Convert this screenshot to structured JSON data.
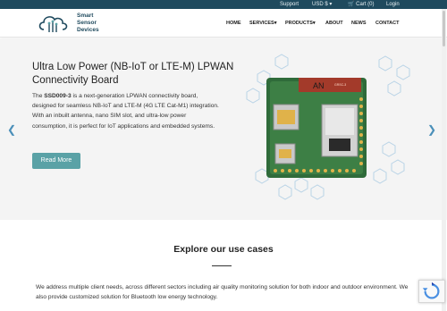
{
  "topbar": {
    "support": "Support",
    "currency": "USD $",
    "cart": "Cart (0)",
    "login": "Login"
  },
  "brand": {
    "line1": "Smart",
    "line2": "Sensor",
    "line3": "Devices",
    "color": "#1f4a5e"
  },
  "nav": {
    "home": "HOME",
    "services": "SERVICES",
    "products": "PRODUCTS",
    "about": "ABOUT",
    "news": "NEWS",
    "contact": "CONTACT"
  },
  "hero": {
    "title": "Ultra Low Power (NB-IoT or LTE-M) LPWAN Connectivity Board",
    "body_prefix": "The ",
    "body_product": "SSD009-3",
    "body_rest": " is a next-generation LPWAN connectivity board, designed for seamless NB-IoT and LTE-M (4G LTE Cat-M1) integration. With an inbuilt antenna, nano SIM slot, and ultra-low power consumption, it is perfect for IoT applications and embedded systems.",
    "button": "Read More",
    "accent": "#5aa2a6",
    "board_label": "AN",
    "board_tag": "GRSC-3"
  },
  "section": {
    "title": "Explore our use cases",
    "description": "We address multiple client needs, across different sectors including air quality monitoring solution for both indoor and outdoor environment. We also provide customized solution for Bluetooth low energy technology."
  },
  "icons": {
    "cart": "cart-icon",
    "prev": "chevron-left-icon",
    "next": "chevron-right-icon",
    "recaptcha": "recaptcha-icon"
  }
}
